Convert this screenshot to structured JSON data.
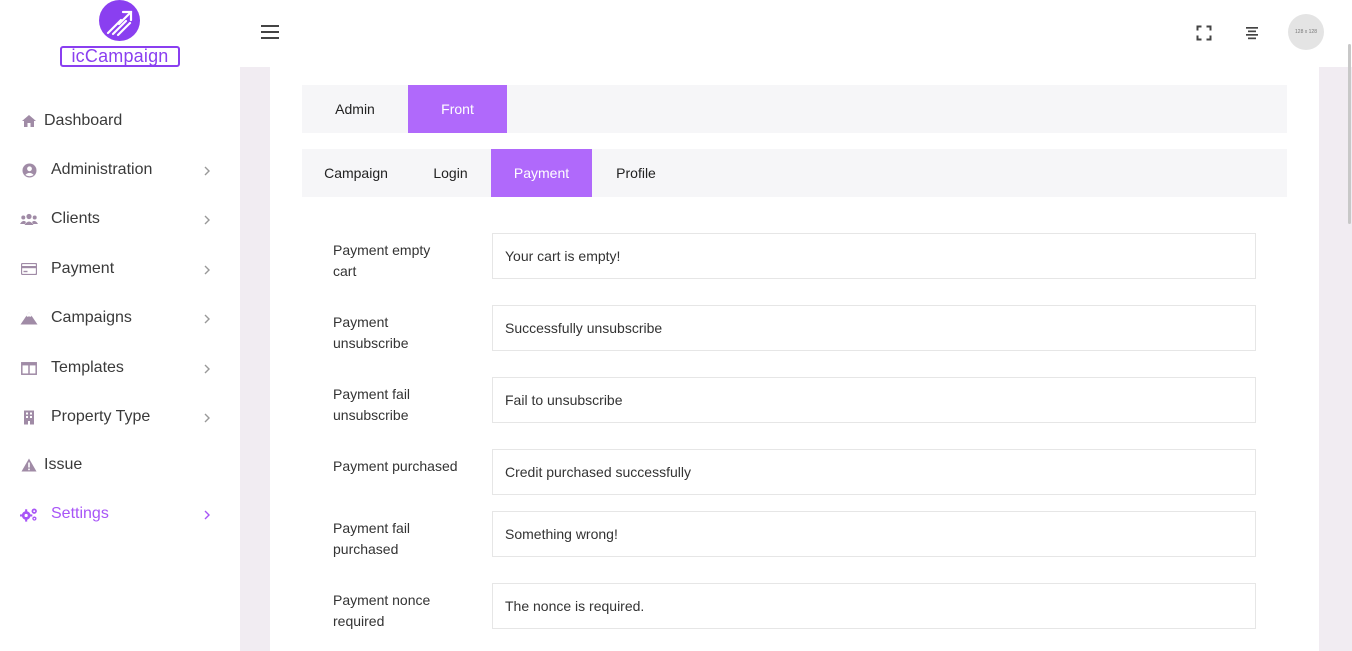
{
  "brand": {
    "logo_text": "icCampaign"
  },
  "sidebar": {
    "items": [
      {
        "label": "Dashboard",
        "icon": "home-icon",
        "has_chevron": false
      },
      {
        "label": "Administration",
        "icon": "user-circle-icon",
        "has_chevron": true
      },
      {
        "label": "Clients",
        "icon": "users-icon",
        "has_chevron": true
      },
      {
        "label": "Payment",
        "icon": "credit-card-icon",
        "has_chevron": true
      },
      {
        "label": "Campaigns",
        "icon": "mountain-icon",
        "has_chevron": true
      },
      {
        "label": "Templates",
        "icon": "columns-icon",
        "has_chevron": true
      },
      {
        "label": "Property Type",
        "icon": "building-icon",
        "has_chevron": true
      },
      {
        "label": "Issue",
        "icon": "warning-icon",
        "has_chevron": false
      },
      {
        "label": "Settings",
        "icon": "gears-icon",
        "has_chevron": true,
        "active": true
      }
    ]
  },
  "header": {
    "avatar_text": "128 x 128",
    "icons": [
      "hamburger-icon",
      "fullscreen-icon",
      "align-center-icon"
    ]
  },
  "tabs_primary": [
    {
      "label": "Admin",
      "active": false
    },
    {
      "label": "Front",
      "active": true
    }
  ],
  "tabs_secondary": [
    {
      "label": "Campaign",
      "active": false
    },
    {
      "label": "Login",
      "active": false
    },
    {
      "label": "Payment",
      "active": true
    },
    {
      "label": "Profile",
      "active": false
    }
  ],
  "form": {
    "rows": [
      {
        "label": "Payment empty cart",
        "value": "Your cart is empty!"
      },
      {
        "label": "Payment unsubscribe",
        "value": "Successfully unsubscribe"
      },
      {
        "label": "Payment fail unsubscribe",
        "value": "Fail to unsubscribe"
      },
      {
        "label": "Payment purchased",
        "value": "Credit purchased successfully"
      },
      {
        "label": "Payment fail purchased",
        "value": "Something wrong!"
      },
      {
        "label": "Payment nonce required",
        "value": "The nonce is required."
      }
    ]
  },
  "colors": {
    "accent": "#a855f7",
    "tab_active": "#b069fb",
    "brand": "#8a3ff0",
    "sidebar_icon": "#a08ba6"
  }
}
